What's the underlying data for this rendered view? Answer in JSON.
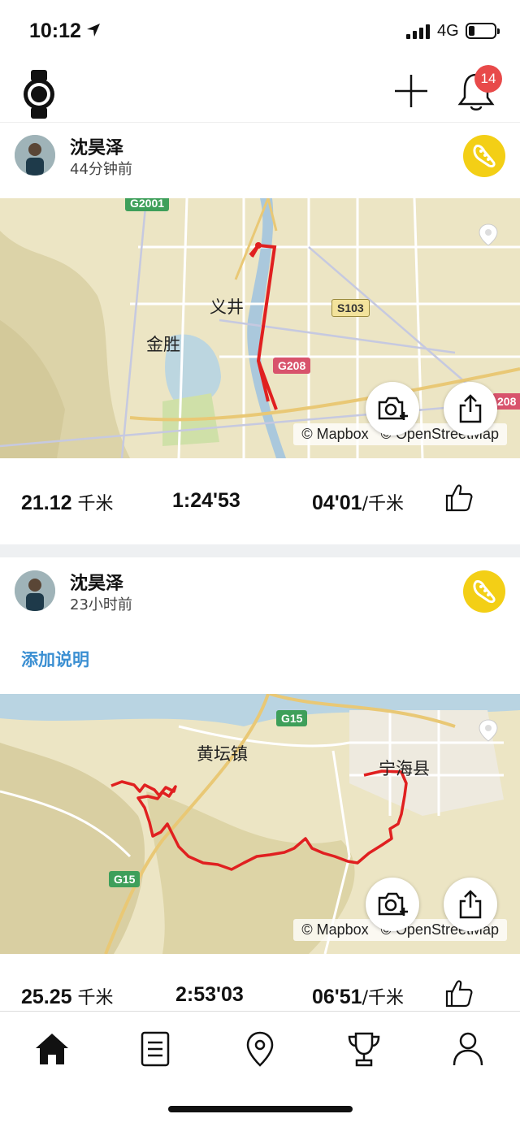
{
  "status_bar": {
    "time": "10:12",
    "network": "4G"
  },
  "header": {
    "notification_count": "14"
  },
  "feed": [
    {
      "user_name": "沈昊泽",
      "time_ago": "44分钟前",
      "map": {
        "place_labels": [
          "义井",
          "金胜"
        ],
        "road_shields": [
          "G2001",
          "S103",
          "G208",
          "208"
        ],
        "attribution_mapbox": "© Mapbox",
        "attribution_osm": "© OpenStreetMap"
      },
      "stats": {
        "distance": "21.12",
        "distance_unit": "千米",
        "duration": "1:24'53",
        "pace": "04'01",
        "pace_unit": "/千米"
      }
    },
    {
      "user_name": "沈昊泽",
      "time_ago": "23小时前",
      "add_description": "添加说明",
      "map": {
        "place_labels": [
          "黄坛镇",
          "宁海县"
        ],
        "road_shields": [
          "G15",
          "G15"
        ],
        "attribution_mapbox": "© Mapbox",
        "attribution_osm": "© OpenStreetMap"
      },
      "stats": {
        "distance": "25.25",
        "distance_unit": "千米",
        "duration": "2:53'03",
        "pace": "06'51",
        "pace_unit": "/千米"
      }
    }
  ],
  "tabs": [
    {
      "name": "home",
      "icon": "home-icon",
      "active": true
    },
    {
      "name": "diary",
      "icon": "list-icon",
      "active": false
    },
    {
      "name": "map",
      "icon": "location-pin-icon",
      "active": false
    },
    {
      "name": "achievements",
      "icon": "trophy-icon",
      "active": false
    },
    {
      "name": "profile",
      "icon": "person-icon",
      "active": false
    }
  ],
  "colors": {
    "accent_yellow": "#f3cf16",
    "route_red": "#e02020",
    "link_blue": "#3b8fd2",
    "badge_red": "#e84a4a"
  }
}
